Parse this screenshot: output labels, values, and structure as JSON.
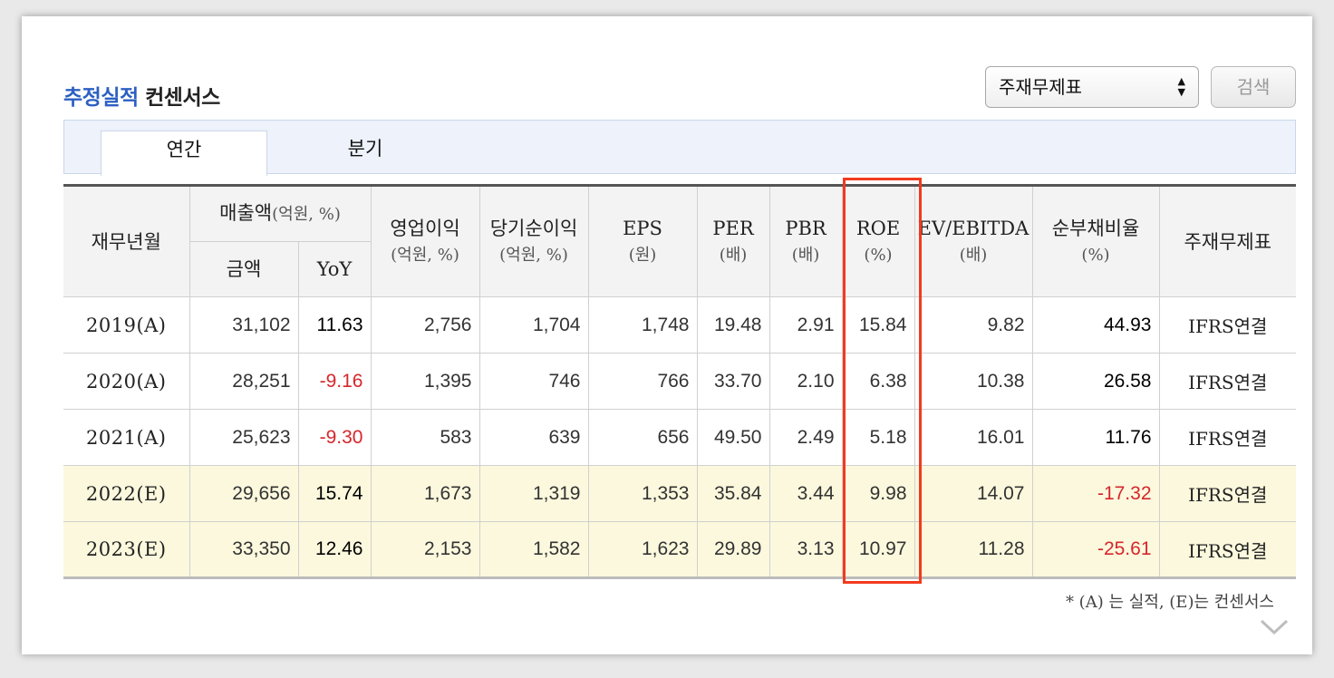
{
  "section": {
    "title_accent": "추정실적",
    "title_rest": " 컨센서스"
  },
  "controls": {
    "select_value": "주재무제표",
    "search_label": "검색"
  },
  "tabs": [
    {
      "label": "연간",
      "active": true
    },
    {
      "label": "분기",
      "active": false
    }
  ],
  "table": {
    "headers": {
      "period": "재무년월",
      "sales": "매출액",
      "sales_unit": "(억원, %)",
      "sales_amount": "금액",
      "sales_yoy": "YoY",
      "op": "영업이익",
      "op_unit": "(억원, %)",
      "net": "당기순이익",
      "net_unit": "(억원, %)",
      "eps": "EPS",
      "eps_unit": "(원)",
      "per": "PER",
      "per_unit": "(배)",
      "pbr": "PBR",
      "pbr_unit": "(배)",
      "roe": "ROE",
      "roe_unit": "(%)",
      "ev": "EV/EBITDA",
      "ev_unit": "(배)",
      "debt": "순부채비율",
      "debt_unit": "(%)",
      "std": "주재무제표"
    },
    "rows": [
      {
        "period": "2019(A)",
        "sales": "31,102",
        "yoy": "11.63",
        "op": "2,756",
        "net": "1,704",
        "eps": "1,748",
        "per": "19.48",
        "pbr": "2.91",
        "roe": "15.84",
        "ev": "9.82",
        "debt": "44.93",
        "std": "IFRS연결"
      },
      {
        "period": "2020(A)",
        "sales": "28,251",
        "yoy": "-9.16",
        "op": "1,395",
        "net": "746",
        "eps": "766",
        "per": "33.70",
        "pbr": "2.10",
        "roe": "6.38",
        "ev": "10.38",
        "debt": "26.58",
        "std": "IFRS연결"
      },
      {
        "period": "2021(A)",
        "sales": "25,623",
        "yoy": "-9.30",
        "op": "583",
        "net": "639",
        "eps": "656",
        "per": "49.50",
        "pbr": "2.49",
        "roe": "5.18",
        "ev": "16.01",
        "debt": "11.76",
        "std": "IFRS연결"
      },
      {
        "period": "2022(E)",
        "sales": "29,656",
        "yoy": "15.74",
        "op": "1,673",
        "net": "1,319",
        "eps": "1,353",
        "per": "35.84",
        "pbr": "3.44",
        "roe": "9.98",
        "ev": "14.07",
        "debt": "-17.32",
        "std": "IFRS연결"
      },
      {
        "period": "2023(E)",
        "sales": "33,350",
        "yoy": "12.46",
        "op": "2,153",
        "net": "1,582",
        "eps": "1,623",
        "per": "29.89",
        "pbr": "3.13",
        "roe": "10.97",
        "ev": "11.28",
        "debt": "-25.61",
        "std": "IFRS연결"
      }
    ]
  },
  "footnote": "* (A) 는 실적, (E)는 컨센서스",
  "colors": {
    "accent": "#2c5fc2",
    "negative": "#d6262b",
    "estimate_row_bg": "#fbf8dd",
    "highlight_box": "#f23a1f"
  },
  "icons": {
    "select_arrows": "updown-arrows-icon",
    "more": "chevron-down-icon"
  }
}
